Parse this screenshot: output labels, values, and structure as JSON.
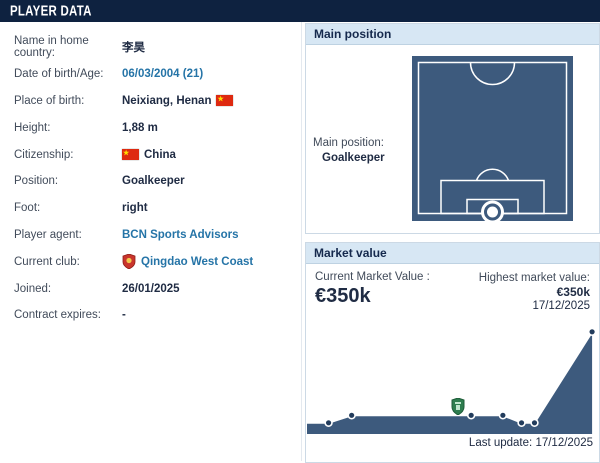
{
  "title": "PLAYER DATA",
  "player_data": {
    "rows": [
      {
        "label": "Name in home country:",
        "value": "李昊",
        "type": "text"
      },
      {
        "label": "Date of birth/Age:",
        "value": "06/03/2004 (21)",
        "type": "link"
      },
      {
        "label": "Place of birth:",
        "value": "Neixiang, Henan",
        "type": "text-flag",
        "flag": "china"
      },
      {
        "label": "Height:",
        "value": "1,88 m",
        "type": "text"
      },
      {
        "label": "Citizenship:",
        "value": "China",
        "type": "flag-text",
        "flag": "china"
      },
      {
        "label": "Position:",
        "value": "Goalkeeper",
        "type": "text"
      },
      {
        "label": "Foot:",
        "value": "right",
        "type": "text"
      },
      {
        "label": "Player agent:",
        "value": "BCN Sports Advisors",
        "type": "link"
      },
      {
        "label": "Current club:",
        "value": "Qingdao West Coast",
        "type": "club"
      },
      {
        "label": "Joined:",
        "value": "26/01/2025",
        "type": "text"
      },
      {
        "label": "Contract expires:",
        "value": "-",
        "type": "text"
      }
    ]
  },
  "main_position": {
    "header": "Main position",
    "label": "Main position:",
    "value": "Goalkeeper"
  },
  "market_value": {
    "header": "Market value",
    "current_label": "Current Market Value :",
    "current_value": "€350k",
    "highest_label": "Highest market value:",
    "highest_value": "€350k",
    "highest_date": "17/12/2025",
    "last_update_label": "Last update:",
    "last_update_date": "17/12/2025"
  },
  "chart_data": {
    "type": "area",
    "unit": "€k",
    "ylim": [
      0,
      350
    ],
    "points": [
      {
        "x": 0.0,
        "value": 50
      },
      {
        "x": 0.075,
        "value": 50
      },
      {
        "x": 0.155,
        "value": 75
      },
      {
        "x": 0.57,
        "value": 75
      },
      {
        "x": 0.68,
        "value": 75
      },
      {
        "x": 0.745,
        "value": 50
      },
      {
        "x": 0.79,
        "value": 50
      },
      {
        "x": 0.99,
        "value": 350
      }
    ],
    "marker": {
      "name": "club-crest-green",
      "x": 0.5,
      "value": 75
    },
    "line_color": "#ffffff",
    "fill_color": "#3d5a7d",
    "dot_color": "#223c5c",
    "legend": "none",
    "grid": false
  },
  "icons": {
    "china_flag": "china-flag",
    "club_crest": "club-crest",
    "chart_marker": "club-crest-green"
  },
  "colors": {
    "navy": "#0e2240",
    "panel_header_bg": "#d7e7f4",
    "link": "#2574a7",
    "pitch_blue": "#3d5a7d",
    "flag_red": "#de2910",
    "flag_yellow": "#ffde00",
    "marker_green": "#2e7d4f"
  }
}
